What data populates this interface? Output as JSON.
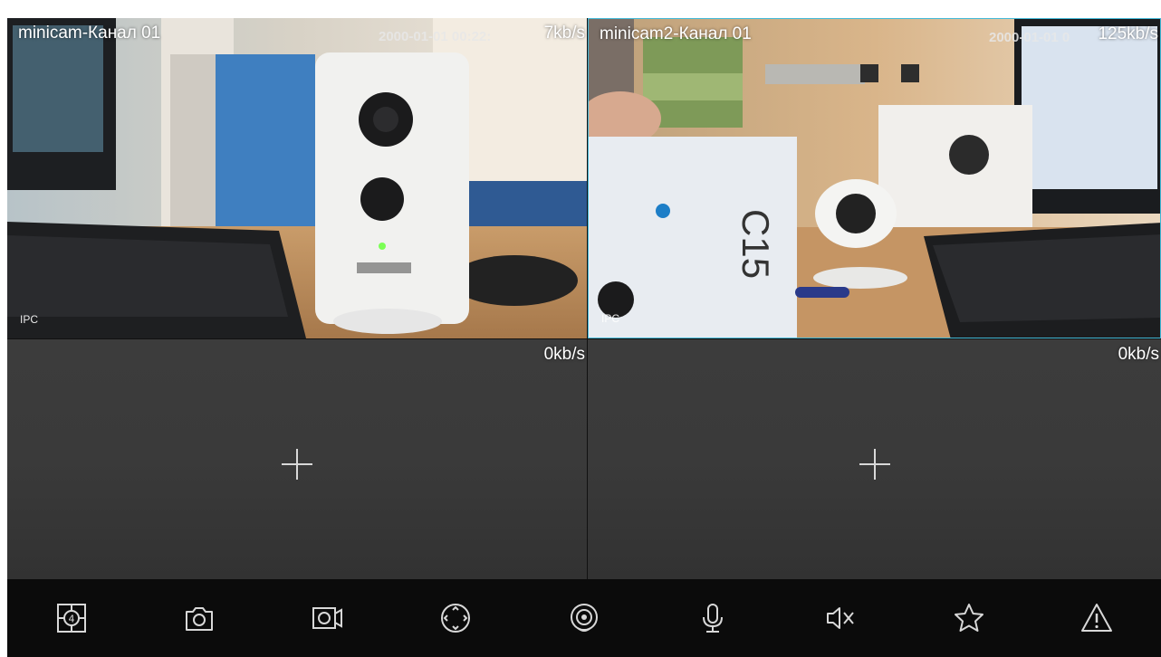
{
  "tiles": [
    {
      "title": "minicam-Канал 01",
      "timestamp": "2000-01-01 00:22:",
      "rate": "7kb/s",
      "badge": "IPC"
    },
    {
      "title": "minicam2-Канал 01",
      "timestamp": "2000-01-01 0",
      "rate": "125kb/s",
      "badge": "IPC"
    },
    {
      "rate": "0kb/s"
    },
    {
      "rate": "0kb/s"
    }
  ],
  "toolbar_icons": [
    "split-screen-icon",
    "camera-icon",
    "video-record-icon",
    "ptz-icon",
    "fisheye-icon",
    "microphone-icon",
    "mute-icon",
    "star-icon",
    "alarm-icon"
  ],
  "colors": {
    "selected_border": "#43b8d6",
    "empty_tile": "#3a3a3a",
    "toolbar_bg": "#0b0b0b"
  }
}
